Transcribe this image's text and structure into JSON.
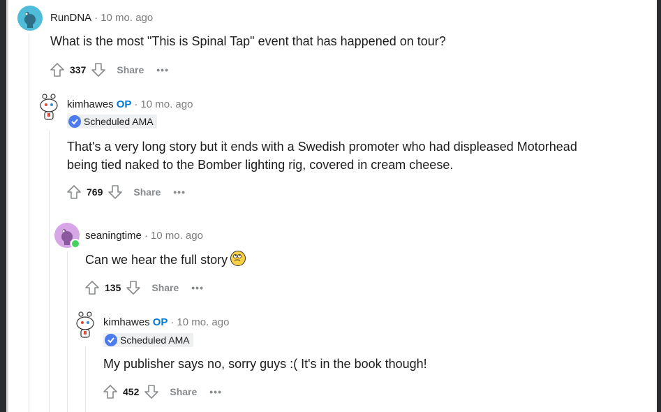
{
  "comments": [
    {
      "author": "RunDNA",
      "op": "",
      "time": "10 mo. ago",
      "flair": "",
      "body_line1": "What is the most \"This is Spinal Tap\" event that has happened on tour?",
      "body_line2": "",
      "votes": "337",
      "share_label": "Share",
      "more_label": "•••",
      "avatar_color": "#4fbcd9"
    },
    {
      "author": "kimhawes",
      "op": "OP",
      "time": "10 mo. ago",
      "flair": "Scheduled AMA",
      "body_line1": "That's a very long story but it ends with a Swedish promoter who had displeased Motorhead",
      "body_line2": "being tied naked to the Bomber lighting rig, covered in cream cheese.",
      "votes": "769",
      "share_label": "Share",
      "more_label": "•••",
      "avatar_color": "#ffffff"
    },
    {
      "author": "seaningtime",
      "op": "",
      "time": "10 mo. ago",
      "flair": "",
      "body_line1": "Can we hear the full story",
      "body_line2": "",
      "votes": "135",
      "share_label": "Share",
      "more_label": "•••",
      "avatar_color": "#d6a6e6"
    },
    {
      "author": "kimhawes",
      "op": "OP",
      "time": "10 mo. ago",
      "flair": "Scheduled AMA",
      "body_line1": "My publisher says no, sorry guys :( It's in the book though!",
      "body_line2": "",
      "votes": "452",
      "share_label": "Share",
      "more_label": "•••",
      "avatar_color": "#ffffff"
    }
  ],
  "icons": {
    "upvote": "upvote-icon",
    "downvote": "downvote-icon",
    "verified": "verified-check-icon",
    "emoji": "rolling-eyes-emoji"
  },
  "colors": {
    "op": "#0079d3",
    "meta": "#7c7c7c",
    "flair_bg": "#edeff1",
    "verified": "#4b7bec",
    "online": "#46d160"
  }
}
